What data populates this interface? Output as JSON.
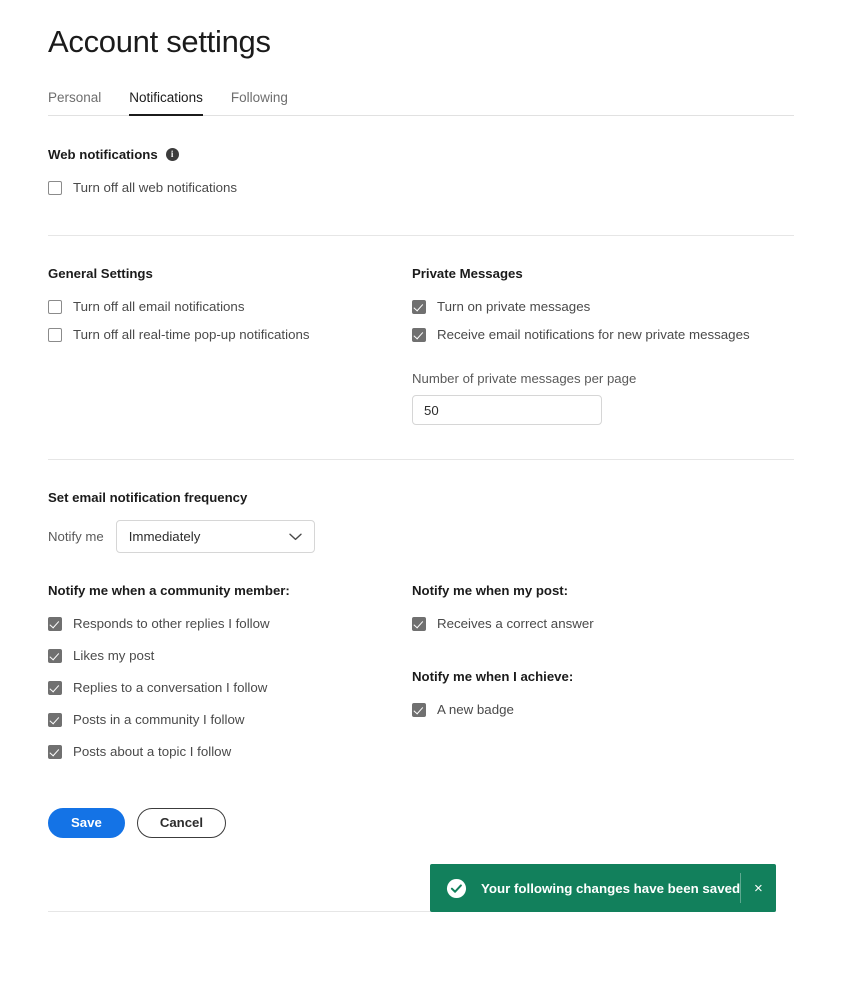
{
  "header": {
    "title": "Account settings"
  },
  "tabs": [
    {
      "label": "Personal",
      "active": false
    },
    {
      "label": "Notifications",
      "active": true
    },
    {
      "label": "Following",
      "active": false
    }
  ],
  "web_notifications": {
    "title": "Web notifications",
    "info_icon": "info-icon",
    "info_glyph": "i",
    "options": [
      {
        "label": "Turn off all web notifications",
        "checked": false
      }
    ]
  },
  "general_settings": {
    "title": "General Settings",
    "options": [
      {
        "label": "Turn off all email notifications",
        "checked": false
      },
      {
        "label": "Turn off all real-time pop-up notifications",
        "checked": false
      }
    ]
  },
  "private_messages": {
    "title": "Private Messages",
    "options": [
      {
        "label": "Turn on private messages",
        "checked": true
      },
      {
        "label": "Receive email notifications for new private messages",
        "checked": true
      }
    ],
    "per_page_label": "Number of private messages per page",
    "per_page_value": "50",
    "per_page_placeholder": "50"
  },
  "frequency": {
    "title": "Set email notification frequency",
    "notify_label": "Notify me",
    "selected": "Immediately",
    "options": [
      "Immediately"
    ],
    "chevron_icon": "chevron-down-icon"
  },
  "community_member": {
    "title": "Notify me when a community member:",
    "options": [
      {
        "label": "Responds to other replies I follow",
        "checked": true
      },
      {
        "label": "Likes my post",
        "checked": true
      },
      {
        "label": "Replies to a conversation I follow",
        "checked": true
      },
      {
        "label": "Posts in a community I follow",
        "checked": true
      },
      {
        "label": "Posts about a topic I follow",
        "checked": true
      }
    ]
  },
  "my_post": {
    "title": "Notify me when my post:",
    "options": [
      {
        "label": "Receives a correct answer",
        "checked": true
      }
    ]
  },
  "achieve": {
    "title": "Notify me when I achieve:",
    "options": [
      {
        "label": "A new badge",
        "checked": true
      }
    ]
  },
  "actions": {
    "save_label": "Save",
    "cancel_label": "Cancel"
  },
  "toast": {
    "message": "Your following changes have been saved",
    "success_icon": "check-circle-icon",
    "close_icon": "close-icon",
    "close_glyph": "×",
    "background_color": "#12805C"
  },
  "colors": {
    "primary_blue": "#1473E6",
    "toast_green": "#12805C",
    "checkbox_gray": "#707070",
    "text_dark": "#1B1B1B"
  }
}
